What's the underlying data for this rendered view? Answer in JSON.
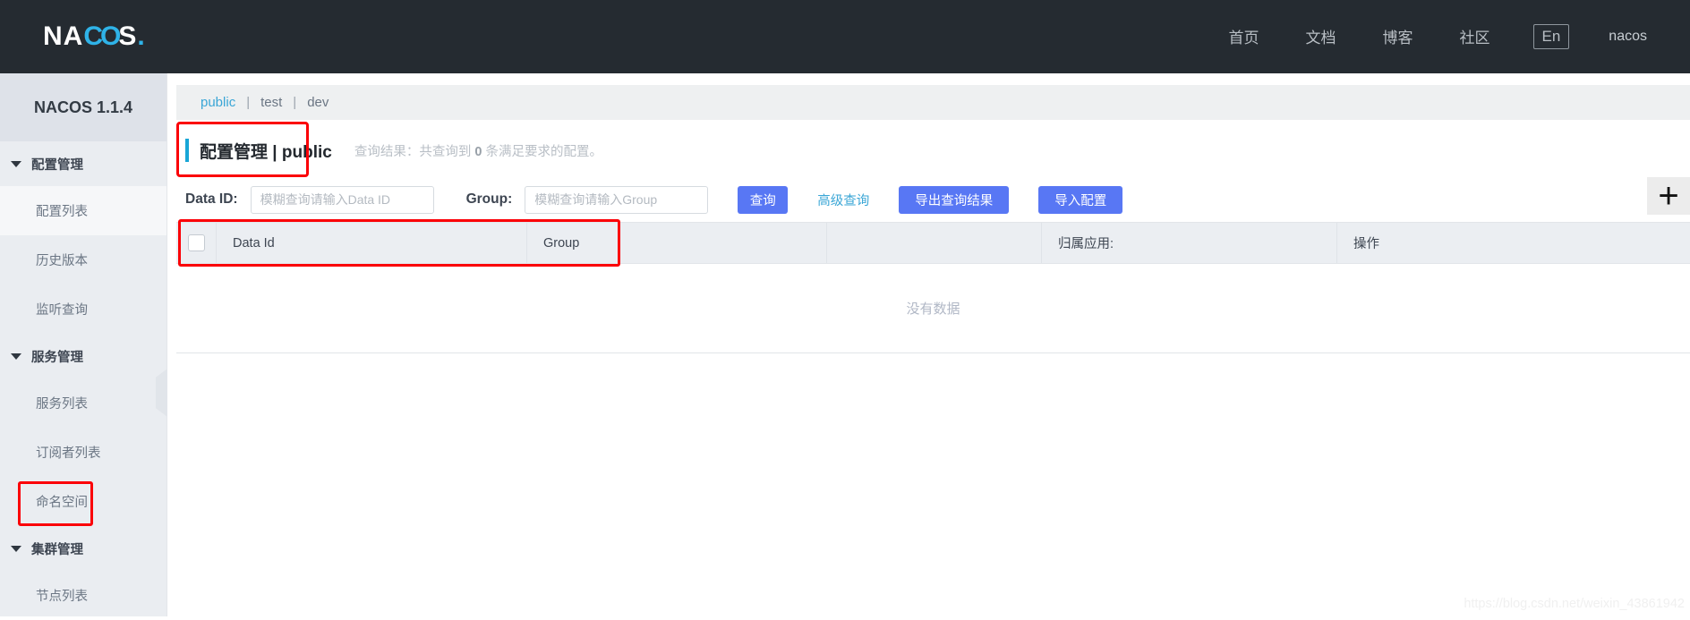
{
  "topbar": {
    "logo": {
      "part1": "NA",
      "part2": "CO",
      "part3": "S",
      "dot": "."
    },
    "nav": [
      {
        "label": "首页",
        "name": "nav-home"
      },
      {
        "label": "文档",
        "name": "nav-docs"
      },
      {
        "label": "博客",
        "name": "nav-blog"
      },
      {
        "label": "社区",
        "name": "nav-community"
      }
    ],
    "lang_button": "En",
    "user": "nacos"
  },
  "sidebar": {
    "title": "NACOS 1.1.4",
    "groups": [
      {
        "label": "配置管理"
      },
      {
        "label": "服务管理"
      },
      {
        "label": "集群管理"
      }
    ],
    "items": [
      {
        "label": "配置列表"
      },
      {
        "label": "历史版本"
      },
      {
        "label": "监听查询"
      },
      {
        "label": "服务列表"
      },
      {
        "label": "订阅者列表"
      },
      {
        "label": "命名空间"
      },
      {
        "label": "节点列表"
      }
    ]
  },
  "namespace_tabs": {
    "tabs": [
      {
        "label": "public",
        "active": true
      },
      {
        "label": "test",
        "active": false
      },
      {
        "label": "dev",
        "active": false
      }
    ],
    "separator": "|"
  },
  "page": {
    "title": "配置管理  |  public",
    "query_result_prefix": "查询结果：共查询到 ",
    "query_result_count": "0",
    "query_result_suffix": " 条满足要求的配置。"
  },
  "search": {
    "data_id_label": "Data ID:",
    "data_id_placeholder": "模糊查询请输入Data ID",
    "data_id_value": "",
    "group_label": "Group:",
    "group_placeholder": "模糊查询请输入Group",
    "group_value": "",
    "query_button": "查询",
    "advanced_query_link": "高级查询",
    "export_button": "导出查询结果",
    "import_button": "导入配置",
    "add_icon": "+"
  },
  "table": {
    "columns": [
      "Data Id",
      "Group",
      "",
      "归属应用:",
      "操作"
    ],
    "rows": [],
    "empty_text": "没有数据"
  },
  "watermark": "https://blog.csdn.net/weixin_43861942",
  "colors": {
    "topbar_bg": "#252b31",
    "accent_blue": "#18a6d6",
    "primary_button": "#5877f4",
    "highlight_red": "#fb0007",
    "sidebar_bg": "#eaedf1"
  }
}
